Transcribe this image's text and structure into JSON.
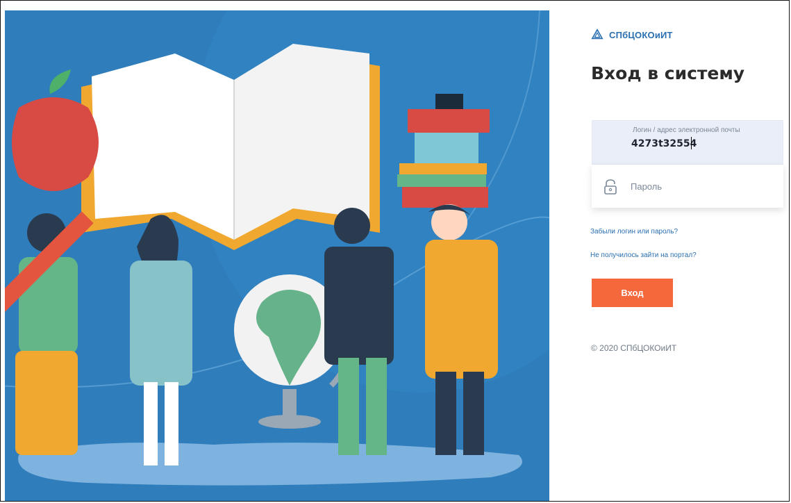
{
  "brand": {
    "name": "СПбЦОКОиИТ",
    "icon": "brand-logo-icon",
    "color": "#2a6fb0"
  },
  "title": "Вход в систему",
  "login": {
    "label": "Логин / адрес электронной почты",
    "value": "4273t32554"
  },
  "password": {
    "placeholder": "Пароль",
    "icon": "lock-icon"
  },
  "links": {
    "forgot": "Забыли логин или пароль?",
    "cant_login": "Не получилось зайти на портал?"
  },
  "button": {
    "label": "Вход",
    "color": "#f4683b"
  },
  "footer": {
    "copyright": "© 2020 СПбЦОКОиИТ"
  },
  "illustration": {
    "name": "education-illustration",
    "background": "#2f7dbb"
  }
}
